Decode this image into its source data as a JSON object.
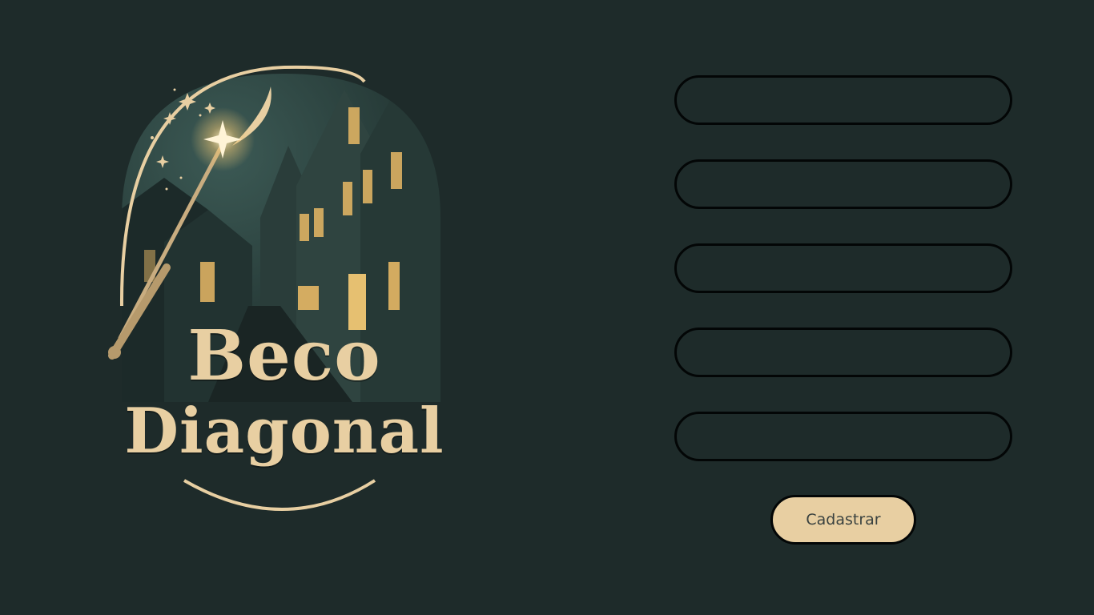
{
  "logo": {
    "title_line1": "Beco",
    "title_line2": "Diagonal",
    "icons": [
      "magic-wand-icon",
      "sparkle-icon",
      "crescent-moon-icon",
      "houses-illustration"
    ]
  },
  "form": {
    "fields": [
      {
        "placeholder": "",
        "value": ""
      },
      {
        "placeholder": "",
        "value": ""
      },
      {
        "placeholder": "",
        "value": ""
      },
      {
        "placeholder": "",
        "value": ""
      },
      {
        "placeholder": "",
        "value": ""
      }
    ],
    "submit_label": "Cadastrar"
  },
  "colors": {
    "background": "#1e2b2a",
    "accent": "#e8cfa2",
    "border": "#030606"
  }
}
